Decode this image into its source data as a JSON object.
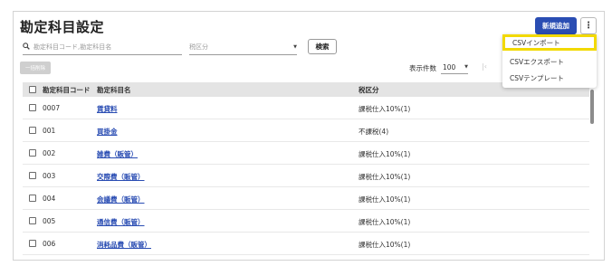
{
  "page": {
    "title": "勘定科目設定"
  },
  "header": {
    "new_button": "新規追加",
    "more_icon": "⋮"
  },
  "filters": {
    "search_placeholder": "勘定科目コード,勘定科目名",
    "tax_placeholder": "税区分",
    "search_button": "検索"
  },
  "toolbar": {
    "bulk_delete": "一括削除",
    "per_page_label": "表示件数",
    "per_page_value": "100"
  },
  "table": {
    "headers": {
      "code": "勘定科目コード",
      "name": "勘定科目名",
      "tax": "税区分"
    },
    "rows": [
      {
        "code": "0007",
        "name": "賃貸料",
        "tax": "課税仕入10%(1)"
      },
      {
        "code": "001",
        "name": "買掛金",
        "tax": "不課税(4)"
      },
      {
        "code": "002",
        "name": "雑費（販管）",
        "tax": "課税仕入10%(1)"
      },
      {
        "code": "003",
        "name": "交際費（販管）",
        "tax": "課税仕入10%(1)"
      },
      {
        "code": "004",
        "name": "会議費（販管）",
        "tax": "課税仕入10%(1)"
      },
      {
        "code": "005",
        "name": "通信費（販管）",
        "tax": "課税仕入10%(1)"
      },
      {
        "code": "006",
        "name": "消耗品費（販管）",
        "tax": "課税仕入10%(1)"
      }
    ]
  },
  "menu": {
    "items": [
      {
        "label": "CSVインポート",
        "highlighted": true
      },
      {
        "label": "CSVエクスポート",
        "highlighted": false
      },
      {
        "label": "CSVテンプレート",
        "highlighted": false
      }
    ]
  },
  "colors": {
    "primary": "#2a4db3",
    "highlight": "#f2d900",
    "header_bg": "#e4e4e4"
  }
}
